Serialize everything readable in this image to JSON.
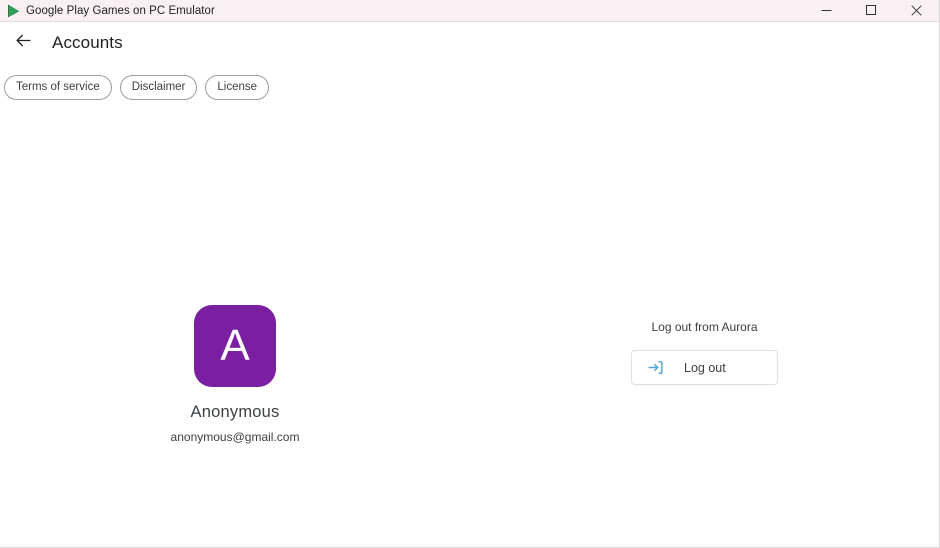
{
  "window": {
    "title": "Google Play Games on PC Emulator",
    "icon": "google-play-icon",
    "controls": {
      "minimize": "minimize-icon",
      "maximize": "maximize-icon",
      "close": "close-icon"
    },
    "titlebar_bg": "#F9F0F4"
  },
  "header": {
    "back_icon": "arrow-left-icon",
    "title": "Accounts"
  },
  "chips": [
    {
      "label": "Terms of service"
    },
    {
      "label": "Disclaimer"
    },
    {
      "label": "License"
    }
  ],
  "profile": {
    "avatar_letter": "A",
    "avatar_color": "#7B1FA2",
    "name": "Anonymous",
    "email": "anonymous@gmail.com"
  },
  "logout": {
    "caption": "Log out from Aurora",
    "icon": "logout-icon",
    "icon_color": "#4FA3D1",
    "button_label": "Log out"
  }
}
